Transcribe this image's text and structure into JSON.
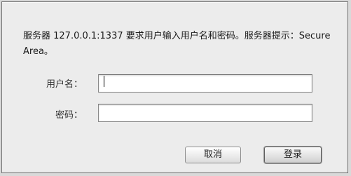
{
  "dialog": {
    "message": "服务器 127.0.0.1:1337 要求用户输入用户名和密码。服务器提示：Secure Area。",
    "username_label": "用户名：",
    "password_label": "密码：",
    "username_value": "",
    "password_value": "",
    "cancel_label": "取消",
    "login_label": "登录"
  }
}
